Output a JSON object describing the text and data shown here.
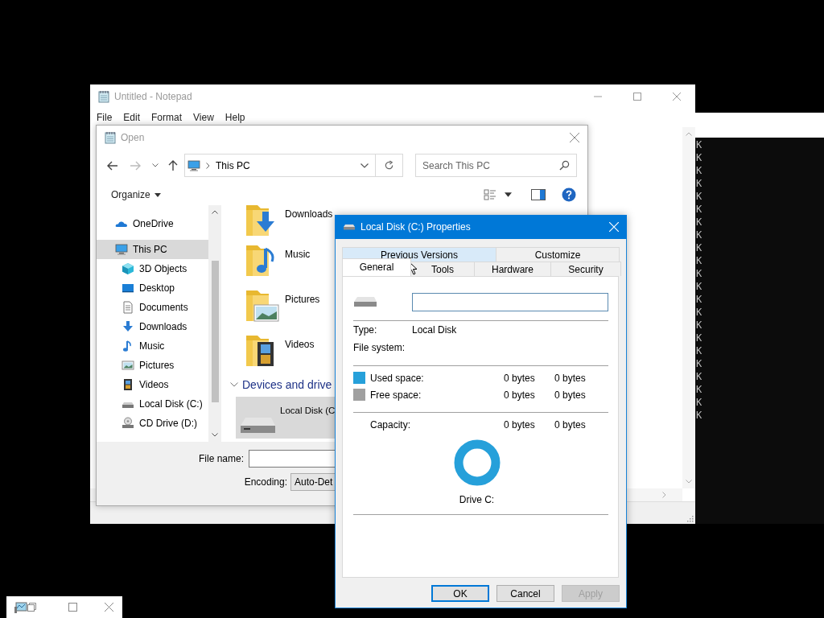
{
  "notepad": {
    "title": "Untitled - Notepad",
    "menu": [
      "File",
      "Edit",
      "Format",
      "View",
      "Help"
    ]
  },
  "terminal": {
    "lines": [
      "K",
      "K",
      "K",
      "K",
      "K",
      "K",
      "K",
      "K",
      "K",
      "K",
      "K",
      "K",
      "K",
      "K",
      "K",
      "K",
      "K",
      "K",
      "K",
      "K",
      "K",
      "K"
    ]
  },
  "open_dialog": {
    "title": "Open",
    "address": "This PC",
    "search": {
      "placeholder": "Search This PC"
    },
    "organize": "Organize",
    "nav_items": [
      {
        "label": "OneDrive",
        "kind": "onedrive",
        "selected": false
      },
      {
        "label": "This PC",
        "kind": "pc",
        "selected": true,
        "children": [
          {
            "label": "3D Objects",
            "kind": "objects3d",
            "selected": false
          },
          {
            "label": "Desktop",
            "kind": "desktop",
            "selected": false
          },
          {
            "label": "Documents",
            "kind": "documents",
            "selected": false
          },
          {
            "label": "Downloads",
            "kind": "downloads",
            "selected": false
          },
          {
            "label": "Music",
            "kind": "music",
            "selected": false
          },
          {
            "label": "Pictures",
            "kind": "pictures",
            "selected": false
          },
          {
            "label": "Videos",
            "kind": "videos",
            "selected": false
          },
          {
            "label": "Local Disk (C:)",
            "kind": "disk",
            "selected": false
          },
          {
            "label": "CD Drive (D:)",
            "kind": "cd",
            "selected": false
          }
        ]
      }
    ],
    "folders": [
      {
        "label": "Downloads",
        "kind": "downloads"
      },
      {
        "label": "Music",
        "kind": "music"
      },
      {
        "label": "Pictures",
        "kind": "pictures"
      },
      {
        "label": "Videos",
        "kind": "videos"
      }
    ],
    "section": "Devices and drive",
    "drives": [
      {
        "label": "Local Disk (C",
        "selected": true
      }
    ],
    "file_name_label": "File name:",
    "encoding_label": "Encoding:",
    "encoding_value": "Auto-Det"
  },
  "properties": {
    "title": "Local Disk (C:) Properties",
    "tab_rows": [
      [
        {
          "label": "Previous Versions",
          "selected": false,
          "hovered": true
        },
        {
          "label": "Customize",
          "selected": false,
          "hovered": false
        }
      ],
      [
        {
          "label": "General",
          "selected": true,
          "hovered": false
        },
        {
          "label": "Tools",
          "selected": false,
          "hovered": false
        },
        {
          "label": "Hardware",
          "selected": false,
          "hovered": false
        },
        {
          "label": "Security",
          "selected": false,
          "hovered": false
        }
      ]
    ],
    "type_label": "Type:",
    "type_value": "Local Disk",
    "fs_label": "File system:",
    "space_rows": [
      {
        "label": "Used space:",
        "color": "#26a0da",
        "value_1": "0 bytes",
        "value_2": "0 bytes"
      },
      {
        "label": "Free space:",
        "color": "#a0a0a0",
        "value_1": "0 bytes",
        "value_2": "0 bytes"
      }
    ],
    "capacity": {
      "label": "Capacity:",
      "value_1": "0 bytes",
      "value_2": "0 bytes"
    },
    "drive_caption": "Drive C:",
    "buttons": [
      {
        "label": "OK",
        "default": true,
        "disabled": false
      },
      {
        "label": "Cancel",
        "default": false,
        "disabled": false
      },
      {
        "label": "Apply",
        "default": false,
        "disabled": true
      }
    ]
  }
}
